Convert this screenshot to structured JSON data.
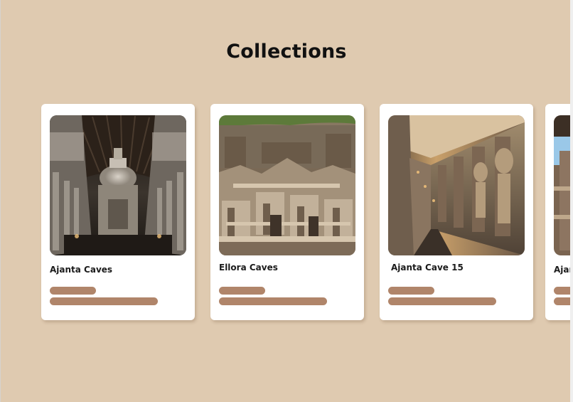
{
  "page": {
    "title": "Collections"
  },
  "collections": [
    {
      "name": "Ajanta Caves",
      "image_icon": "ajanta-chaitya-hall-image"
    },
    {
      "name": "Ellora Caves",
      "image_icon": "ellora-kailasa-temple-image"
    },
    {
      "name": "Ajanta Cave 15",
      "image_icon": "ajanta-cave-corridor-image"
    },
    {
      "name": "Ajanta Caves",
      "image_icon": "ajanta-cliff-image"
    }
  ],
  "colors": {
    "background": "#dfcab0",
    "card": "#ffffff",
    "accent_pill": "#b0856a"
  }
}
